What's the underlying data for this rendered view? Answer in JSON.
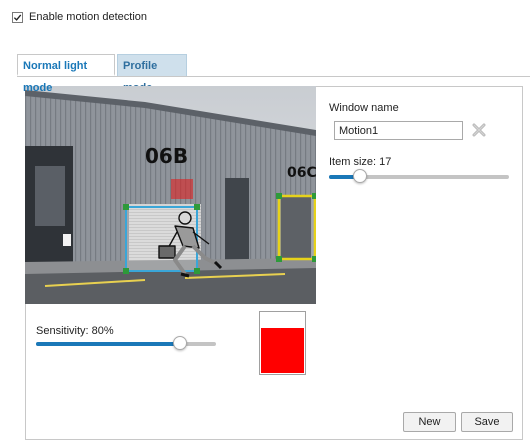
{
  "enable": {
    "label": "Enable motion detection",
    "checked": true
  },
  "tabs": [
    {
      "label": "Normal light mode",
      "active": true
    },
    {
      "label": "Profile mode",
      "active": false
    }
  ],
  "camera": {
    "building_label_left": "06B",
    "building_label_right": "06C",
    "windows": [
      {
        "color": "#3aa6d8"
      },
      {
        "color": "#e6d21a"
      }
    ],
    "highlight_color": "#e02020"
  },
  "sensitivity": {
    "label": "Sensitivity: 80%",
    "value": 80
  },
  "level": {
    "fill_percent": 75,
    "color": "#ff0000"
  },
  "window_name": {
    "label": "Window name",
    "value": "Motion1"
  },
  "item_size": {
    "label": "Item size: 17",
    "value": 17,
    "max": 100
  },
  "buttons": {
    "new_label": "New",
    "save_label": "Save"
  }
}
